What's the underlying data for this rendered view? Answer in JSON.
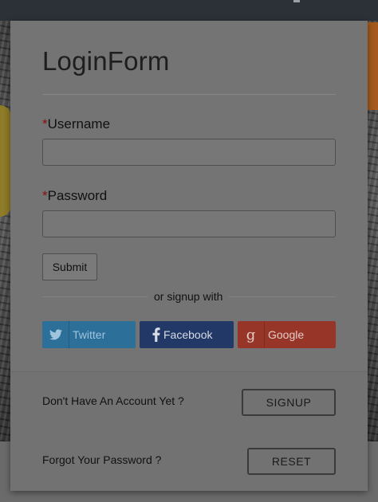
{
  "form": {
    "title": "LoginForm",
    "required_mark": "*",
    "username_label": "Username",
    "username_value": "",
    "password_label": "Password",
    "password_value": "",
    "submit_label": "Submit",
    "divider_text": "or signup with"
  },
  "social": [
    {
      "label": "Twitter",
      "icon": "twitter-icon",
      "color": "#2c6f98"
    },
    {
      "label": "Facebook",
      "icon": "facebook-icon",
      "color": "#223866"
    },
    {
      "label": "Google",
      "icon": "google-icon",
      "color": "#973628"
    }
  ],
  "footer": {
    "signup_prompt": "Don't Have An Account Yet ?",
    "signup_label": "SIGNUP",
    "forgot_prompt": "Forgot Your Password ?",
    "reset_label": "RESET"
  }
}
